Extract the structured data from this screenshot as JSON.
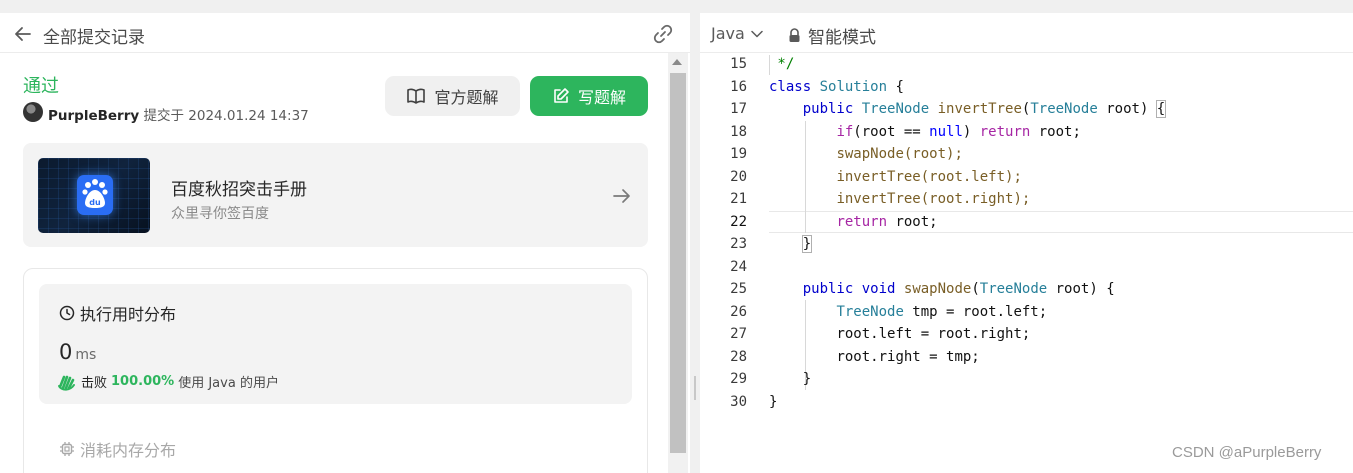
{
  "left_panel": {
    "header": {
      "back_icon": "arrow-left-icon",
      "title": "全部提交记录",
      "link_icon": "link-icon"
    },
    "submission": {
      "status": "通过",
      "user": "PurpleBerry",
      "submitted_label": "提交于 2024.01.24 14:37"
    },
    "buttons": {
      "official_solution": "官方题解",
      "write_solution": "写题解"
    },
    "ad": {
      "title": "百度秋招突击手册",
      "subtitle": "众里寻你签百度",
      "logo_text": "du"
    },
    "runtime": {
      "title": "执行用时分布",
      "value": "0",
      "unit": "ms",
      "beats_label": "击败",
      "beats_pct": "100.00%",
      "beats_suffix": "使用 Java 的用户"
    },
    "memory": {
      "title": "消耗内存分布"
    }
  },
  "editor": {
    "language": "Java",
    "mode": "智能模式",
    "lines": [
      {
        "n": "15"
      },
      {
        "n": "16"
      },
      {
        "n": "17"
      },
      {
        "n": "18"
      },
      {
        "n": "19"
      },
      {
        "n": "20"
      },
      {
        "n": "21"
      },
      {
        "n": "22"
      },
      {
        "n": "23"
      },
      {
        "n": "24"
      },
      {
        "n": "25"
      },
      {
        "n": "26"
      },
      {
        "n": "27"
      },
      {
        "n": "28"
      },
      {
        "n": "29"
      },
      {
        "n": "30"
      }
    ],
    "code": {
      "l15": " */",
      "l16_kw": "class",
      "l16_name": "Solution",
      "l16_rest": " {",
      "l17_kw": "public",
      "l17_type": "TreeNode",
      "l17_fn": "invertTree",
      "l17_ptype": "TreeNode",
      "l17_param": "root",
      "l18_kw": "if",
      "l18_mid": "(root == ",
      "l18_null": "null",
      "l18_ret": "return",
      "l18_rest": " root;",
      "l19": "swapNode(root);",
      "l20": "invertTree(root.left);",
      "l21": "invertTree(root.right);",
      "l22_kw": "return",
      "l22_rest": " root;",
      "l23": "}",
      "l25_kw": "public",
      "l25_void": "void",
      "l25_fn": "swapNode",
      "l25_ptype": "TreeNode",
      "l25_rest": " root) {",
      "l26_type": "TreeNode",
      "l26_rest": " tmp = root.left;",
      "l27": "root.left = root.right;",
      "l28": "root.right = tmp;",
      "l29": "}",
      "l30": "}"
    }
  },
  "watermark": "CSDN @aPurpleBerry",
  "colors": {
    "accent_green": "#2db55d",
    "keyword": "#0000cc",
    "type": "#267f99"
  }
}
